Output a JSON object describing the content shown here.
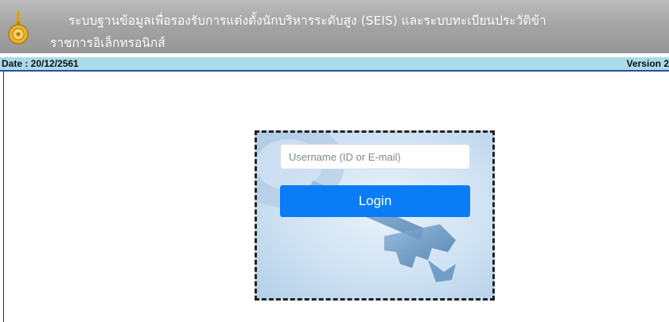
{
  "header": {
    "title_line1": "ระบบฐานข้อมูลเพื่อรองรับการแต่งตั้งนักบริหารระดับสูง (SEIS) และระบบทะเบียนประวัติข้า",
    "title_line2": "ราชการอิเล็กทรอนิกส์",
    "logo_icon": "thai-government-emblem"
  },
  "infobar": {
    "date": "Date : 20/12/2561",
    "version": "Version 2"
  },
  "login": {
    "username_placeholder": "Username (ID or E-mail)",
    "username_value": "",
    "button_label": "Login",
    "button_color": "#0a7cf6",
    "background_art": "key-icon"
  },
  "colors": {
    "header_bg": "#a3a3a3",
    "infobar_bg": "#a9dbe9",
    "infobar_border": "#2c4fa1"
  }
}
